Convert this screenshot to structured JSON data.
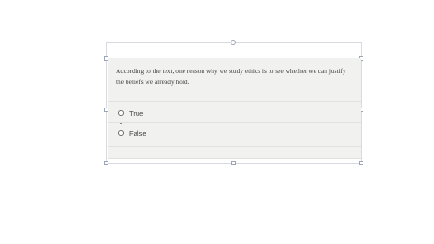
{
  "question": {
    "text": "According to the text, one reason why we study ethics is to see whether we can justify the beliefs we already hold."
  },
  "options": [
    {
      "label": "True",
      "selected": false
    },
    {
      "label": "False",
      "selected": false
    }
  ],
  "colors": {
    "card_background": "#f1f2f0",
    "selection_border": "#9aa6b8"
  }
}
